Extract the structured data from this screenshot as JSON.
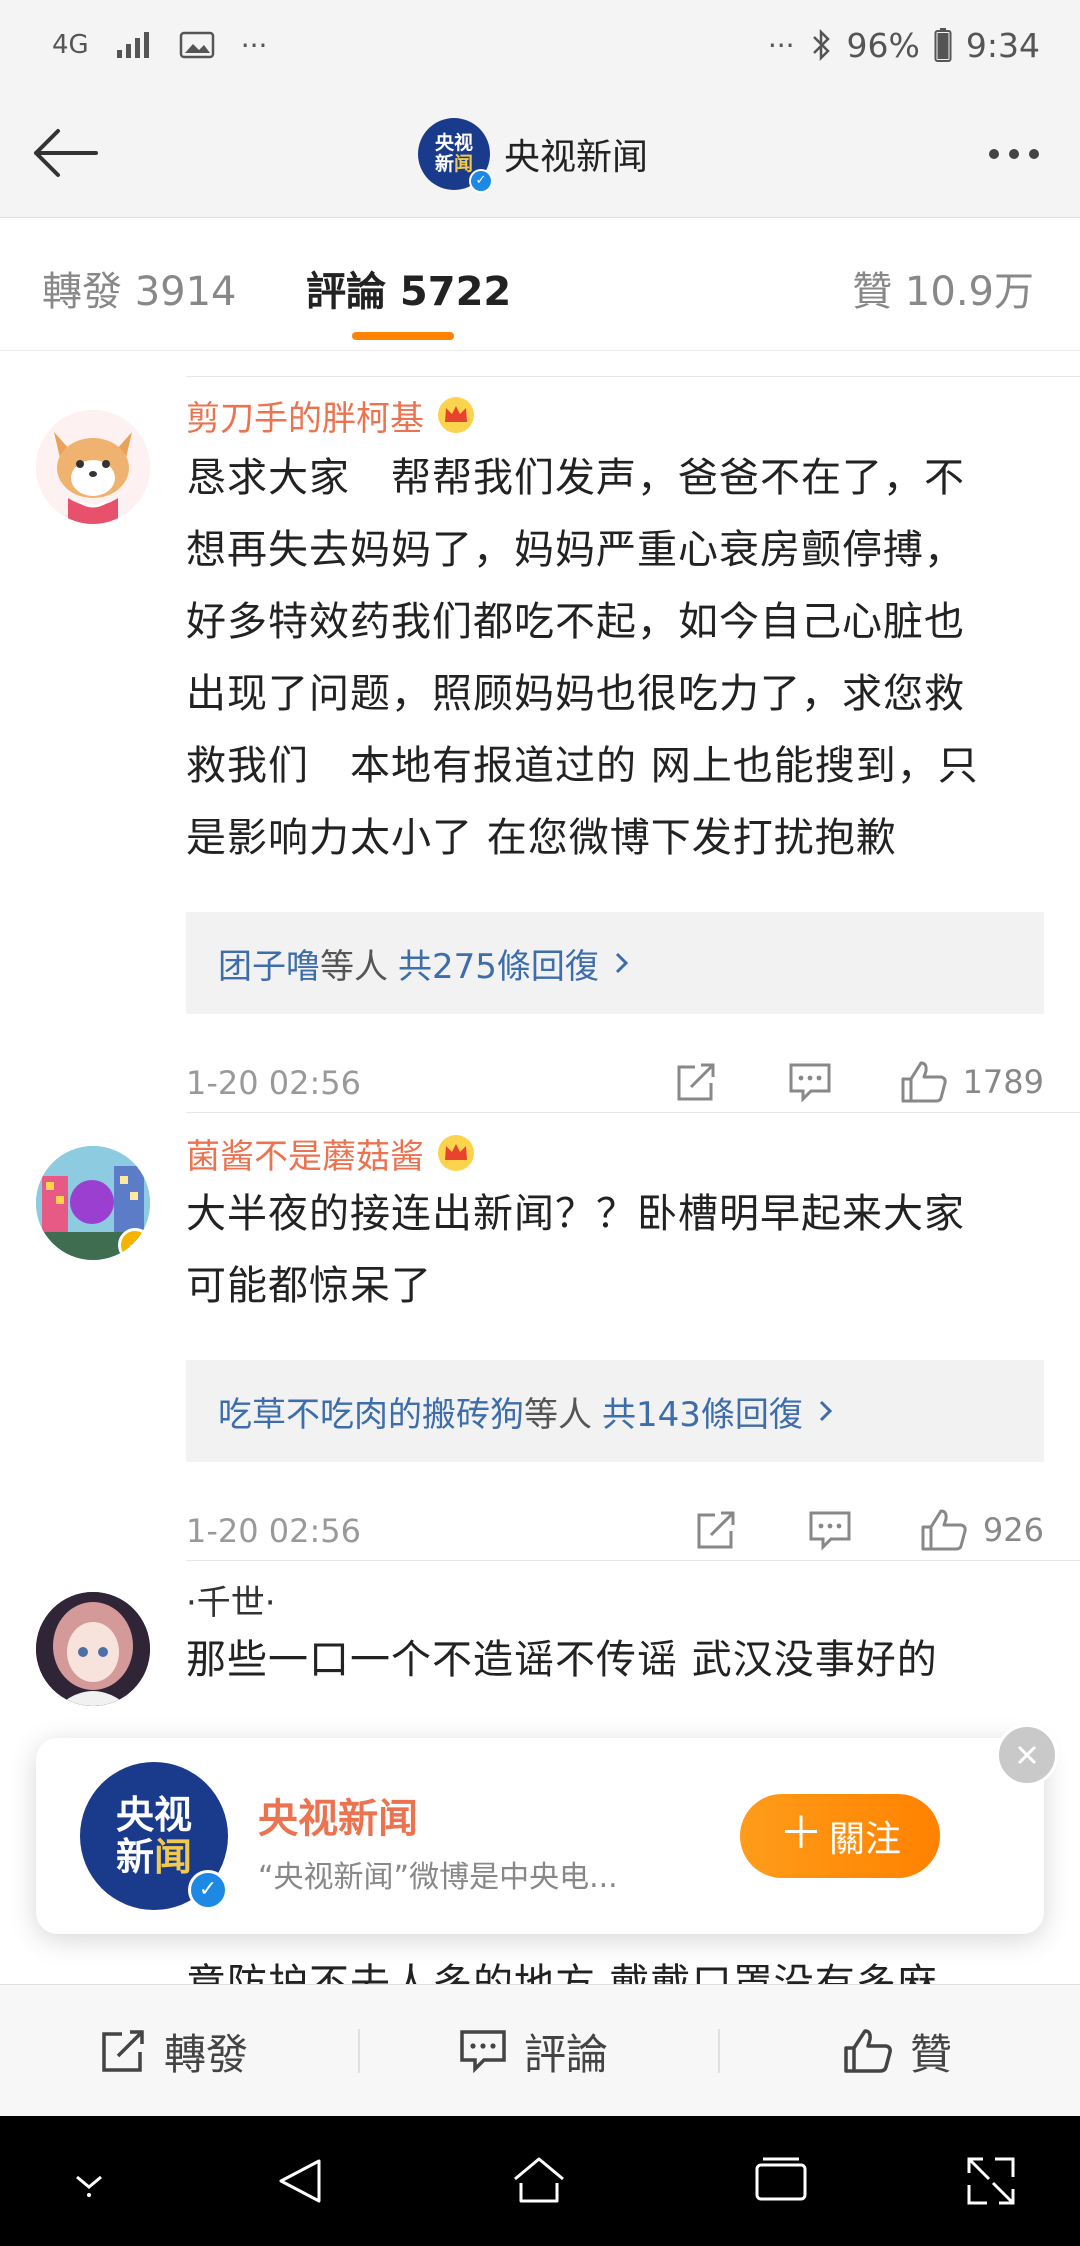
{
  "status_bar": {
    "network": "4G",
    "more_left": "···",
    "more_right": "···",
    "battery": "96%",
    "time": "9:34"
  },
  "nav": {
    "title": "央视新闻",
    "avatar_line1": "央视",
    "avatar_line2a": "新",
    "avatar_line2b": "闻"
  },
  "tabs": {
    "repost": "轉發 3914",
    "comments": "評論 5722",
    "likes": "贊 10.9万"
  },
  "comments": [
    {
      "username": "剪刀手的胖柯基",
      "text_lines": [
        "恳求大家　帮帮我们发声，爸爸不在了，不",
        "想再失去妈妈了，妈妈严重心衰房颤停搏，",
        "好多特效药我们都吃不起，如今自己心脏也",
        "出现了问题，照顾妈妈也很吃力了，求您救",
        "救我们　本地有报道过的 网上也能搜到，只",
        "是影响力太小了 在您微博下发打扰抱歉"
      ],
      "reply_names": "团子噜",
      "reply_mid": "等人",
      "reply_count": "共275條回復",
      "time": "1-20 02:56",
      "likes": "1789"
    },
    {
      "username": "菌酱不是蘑菇酱",
      "text_lines": [
        "大半夜的接连出新闻？？卧槽明早起来大家",
        "可能都惊呆了"
      ],
      "reply_names": "吃草不吃肉的搬砖狗",
      "reply_mid": "等人",
      "reply_count": "共143條回復",
      "time": "1-20 02:56",
      "likes": "926"
    },
    {
      "username": "·千世·",
      "text_lines": [
        "那些一口一个不造谣不传谣 武汉没事好的",
        "意防护不去人多的地方 戴戴口罩没有多麻"
      ]
    }
  ],
  "banner": {
    "name": "央视新闻",
    "description": "“央视新闻”微博是中央电...",
    "follow_label": "關注",
    "follow_plus": "＋",
    "avatar_line1": "央视",
    "avatar_line2a": "新",
    "avatar_line2b": "闻"
  },
  "bottom_bar": {
    "repost": "轉發",
    "comment": "評論",
    "like": "贊"
  },
  "colors": {
    "accent": "#ff8200",
    "username": "#eb7350",
    "link": "#3d6dab",
    "verified": "#1e88e5"
  }
}
